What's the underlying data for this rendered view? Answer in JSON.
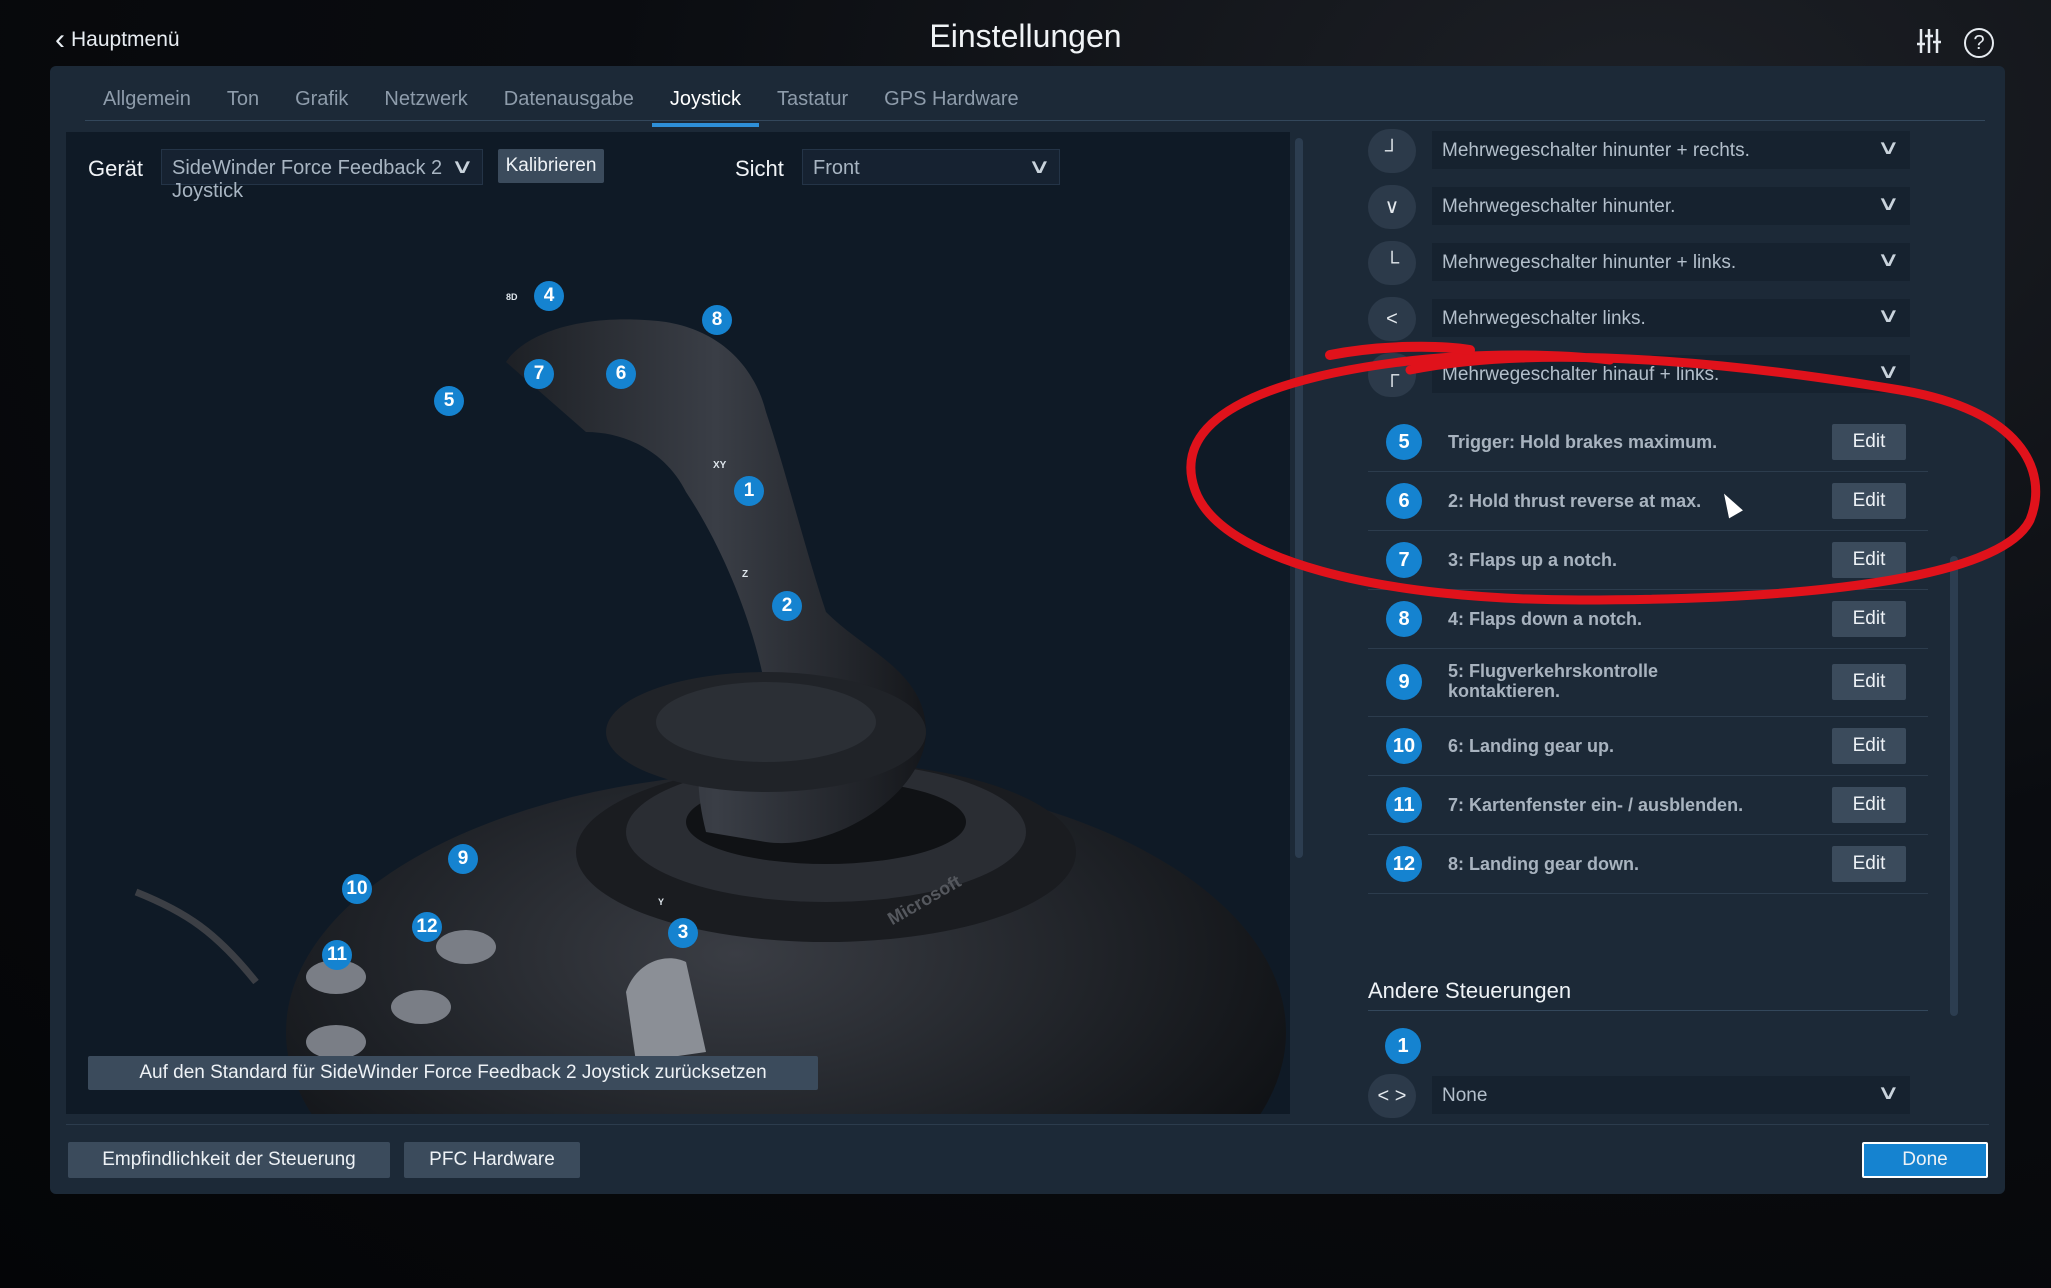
{
  "topbar": {
    "back_label": "Hauptmenü",
    "title": "Einstellungen",
    "help_symbol": "?"
  },
  "tabs": [
    {
      "label": "Allgemein",
      "active": false
    },
    {
      "label": "Ton",
      "active": false
    },
    {
      "label": "Grafik",
      "active": false
    },
    {
      "label": "Netzwerk",
      "active": false
    },
    {
      "label": "Datenausgabe",
      "active": false
    },
    {
      "label": "Joystick",
      "active": true
    },
    {
      "label": "Tastatur",
      "active": false
    },
    {
      "label": "GPS Hardware",
      "active": false
    }
  ],
  "device": {
    "label": "Gerät",
    "value": "SideWinder Force Feedback 2 Joystick",
    "calibrate_label": "Kalibrieren"
  },
  "view": {
    "label": "Sicht",
    "value": "Front"
  },
  "joystick_hotspots": {
    "h1": "1",
    "h2": "2",
    "h3": "3",
    "h4": "4",
    "h5": "5",
    "h6": "6",
    "h7": "7",
    "h8": "8",
    "h9": "9",
    "h10": "10",
    "h11": "11",
    "h12": "12",
    "hat_marker": "8D",
    "xy_marker": "XY",
    "z_marker": "Z",
    "y_marker": "Y",
    "brand": "Microsoft"
  },
  "reset_label": "Auf den Standard für SideWinder Force Feedback 2 Joystick zurücksetzen",
  "hat_rows": [
    {
      "icon": "┘",
      "value": "Mehrwegeschalter hinunter + rechts."
    },
    {
      "icon": "∨",
      "value": "Mehrwegeschalter hinunter."
    },
    {
      "icon": "└",
      "value": "Mehrwegeschalter hinunter + links."
    },
    {
      "icon": "<",
      "value": "Mehrwegeschalter links."
    },
    {
      "icon": "┌",
      "value": "Mehrwegeschalter hinauf + links."
    }
  ],
  "buttons": [
    {
      "num": "5",
      "text": "Trigger: Hold brakes maximum.",
      "edit": "Edit"
    },
    {
      "num": "6",
      "text": "2: Hold thrust reverse at max.",
      "edit": "Edit"
    },
    {
      "num": "7",
      "text": "3: Flaps up a notch.",
      "edit": "Edit"
    },
    {
      "num": "8",
      "text": "4: Flaps down a notch.",
      "edit": "Edit"
    },
    {
      "num": "9",
      "text": "5: Flugverkehrskontrolle kontaktieren.",
      "edit": "Edit"
    },
    {
      "num": "10",
      "text": "6: Landing gear up.",
      "edit": "Edit"
    },
    {
      "num": "11",
      "text": "7: Kartenfenster ein- / ausblenden.",
      "edit": "Edit"
    },
    {
      "num": "12",
      "text": "8: Landing gear down.",
      "edit": "Edit"
    }
  ],
  "other_controls": {
    "heading": "Andere Steuerungen",
    "badge": "1",
    "axis_icon": "< >",
    "value": "None"
  },
  "footer": {
    "sensitivity_label": "Empfindlichkeit der Steuerung",
    "pfc_label": "PFC Hardware",
    "done_label": "Done"
  },
  "colors": {
    "accent": "#1583d0",
    "panel": "#1c2937",
    "annotation": "#e0121b"
  }
}
